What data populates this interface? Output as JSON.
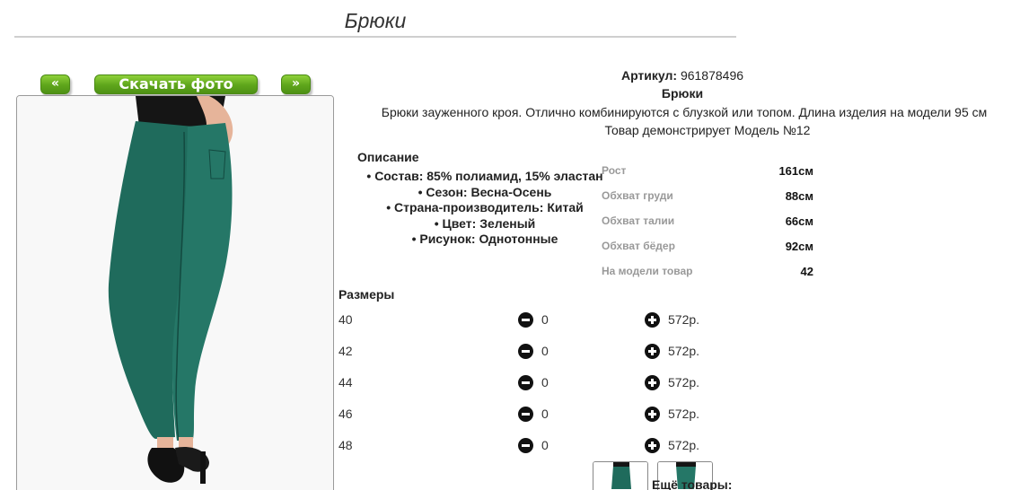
{
  "page": {
    "title": "Брюки"
  },
  "photo_nav": {
    "prev_label": "«",
    "download_label": "Скачать фото",
    "next_label": "»"
  },
  "product": {
    "sku_label": "Артикул:",
    "sku_value": "961878496",
    "name": "Брюки",
    "description": "Брюки зауженного кроя. Отлично комбинируются с блузкой или топом. Длина изделия на модели 95 см",
    "model_demo": "Товар демонстрирует Модель №12"
  },
  "description_block": {
    "title": "Описание",
    "items": [
      "Состав: 85% полиамид, 15% эластан",
      "Сезон: Весна-Осень",
      "Страна-производитель: Китай",
      "Цвет: Зеленый",
      "Рисунок: Однотонные"
    ]
  },
  "measurements": [
    {
      "label": "Рост",
      "value": "161см"
    },
    {
      "label": "Обхват груди",
      "value": "88см"
    },
    {
      "label": "Обхват талии",
      "value": "66см"
    },
    {
      "label": "Обхват бёдер",
      "value": "92см"
    },
    {
      "label": "На модели товар",
      "value": "42"
    }
  ],
  "sizes": {
    "title": "Размеры",
    "rows": [
      {
        "size": "40",
        "qty": "0",
        "price": "572р."
      },
      {
        "size": "42",
        "qty": "0",
        "price": "572р."
      },
      {
        "size": "44",
        "qty": "0",
        "price": "572р."
      },
      {
        "size": "46",
        "qty": "0",
        "price": "572р."
      },
      {
        "size": "48",
        "qty": "0",
        "price": "572р."
      }
    ]
  },
  "more_goods_label": "Ещё товары:",
  "colors": {
    "accent_green": "#5ea51b",
    "pants_green": "#1f6b5c"
  }
}
